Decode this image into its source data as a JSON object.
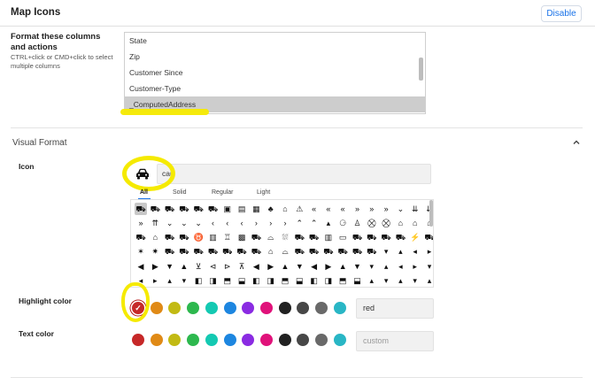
{
  "header": {
    "title": "Map Icons",
    "disable_label": "Disable"
  },
  "format_columns": {
    "label": "Format these columns and actions",
    "hint": "CTRL+click or CMD+click to select multiple columns",
    "options": [
      "State",
      "Zip",
      "Customer Since",
      "Customer-Type",
      "_ComputedAddress"
    ],
    "selected": "_ComputedAddress"
  },
  "visual_format": {
    "section_title": "Visual Format",
    "icon": {
      "label": "Icon",
      "search_value": "car",
      "selected_icon": "car-icon",
      "tabs": [
        "All",
        "Solid",
        "Regular",
        "Light"
      ],
      "active_tab": "All",
      "grid_rows": [
        [
          "car-icon",
          "car-side-icon",
          "truck-icon",
          "truck-moving-icon",
          "truck-pickup-icon",
          "truck-front-icon",
          "id-card-icon",
          "address-card-icon",
          "calendar-icon",
          "tree-icon",
          "house-icon",
          "warning-icon",
          "chevrons-left-icon",
          "chevrons-left-icon",
          "double-angle-left-icon",
          "double-angle-right-icon",
          "chevrons-right-icon",
          "chevrons-right-icon",
          "chevron-down-icon",
          "double-chevron-down-icon",
          "double-chevron-down-icon"
        ],
        [
          "double-angle-right-icon",
          "double-angle-up-icon",
          "angle-down-icon",
          "chevron-down-icon",
          "chevron-down-icon",
          "chevron-left-icon",
          "chevron-left-icon",
          "angle-left-icon",
          "angle-right-icon",
          "angle-right-icon",
          "chevron-right-icon",
          "angle-up-icon",
          "chevron-up-icon",
          "caret-up-icon",
          "baby-carriage-icon",
          "chair-icon",
          "cart-icon",
          "cart-icon",
          "garage-icon",
          "garage-icon",
          "garage-icon"
        ],
        [
          "car-front-icon",
          "car-garage-icon",
          "car-side-icon",
          "tractor-icon",
          "cow-icon",
          "bus-icon",
          "beer-icon",
          "car-building-icon",
          "car-front-icon",
          "car-tunnel-icon",
          "car-wash-icon",
          "car-icon",
          "car-alt-icon",
          "car-bus-icon",
          "car-battery-icon",
          "truck-icon",
          "car-mirror-icon",
          "car-side-icon",
          "car-tilt-icon",
          "car-bolt-icon",
          "car-rear-icon"
        ],
        [
          "car-crash-icon",
          "car-burst-icon",
          "truck-icon",
          "car-side-icon",
          "truck-ramp-icon",
          "car-tow-icon",
          "car-side-icon",
          "car-front-icon",
          "car-on-icon",
          "car-garage-icon",
          "car-tunnel-icon",
          "car-side-icon",
          "car-front-icon",
          "car-alt-icon",
          "car-tilt-icon",
          "car-side-icon",
          "car-rear-icon",
          "caret-down-icon",
          "caret-up-icon",
          "caret-left-icon",
          "caret-right-icon"
        ],
        [
          "circle-caret-left-icon",
          "circle-caret-right-icon",
          "circle-caret-down-icon",
          "circle-caret-up-icon",
          "circle-chevron-down-icon",
          "circle-chevron-left-icon",
          "circle-chevron-right-icon",
          "circle-chevron-up-icon",
          "circle-caret-left-icon",
          "circle-caret-right-icon",
          "circle-caret-up-icon",
          "circle-caret-down-icon",
          "circle-caret-left-icon",
          "circle-caret-right-icon",
          "circle-caret-up-icon",
          "circle-caret-down-icon",
          "caret-down-icon",
          "caret-up-icon",
          "caret-left-icon",
          "caret-right-icon",
          "caret-down-icon"
        ],
        [
          "caret-left-icon",
          "caret-right-icon",
          "caret-up-icon",
          "caret-down-icon",
          "square-caret-left-icon",
          "square-caret-right-icon",
          "square-caret-up-icon",
          "square-caret-down-icon",
          "square-caret-left-icon",
          "square-caret-right-icon",
          "square-caret-up-icon",
          "square-caret-down-icon",
          "square-caret-left-icon",
          "square-caret-right-icon",
          "square-caret-up-icon",
          "square-caret-down-icon",
          "caret-up-icon",
          "caret-down-icon",
          "caret-up-icon",
          "caret-down-icon",
          "caret-up-icon"
        ]
      ]
    },
    "highlight_color": {
      "label": "Highlight color",
      "value": "red",
      "selected": "#c62828"
    },
    "text_color": {
      "label": "Text color",
      "placeholder": "custom"
    },
    "palette": [
      "#c62828",
      "#e08a16",
      "#c2ba14",
      "#2db84e",
      "#14c9b2",
      "#1d86e0",
      "#8a2be2",
      "#e0127a",
      "#212121",
      "#474747",
      "#696969",
      "#29b6c5"
    ]
  }
}
